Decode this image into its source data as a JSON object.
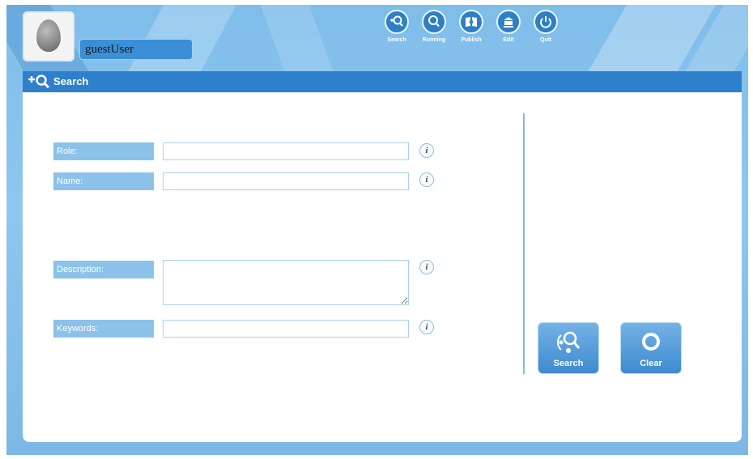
{
  "user": {
    "name": "guestUser"
  },
  "nav": [
    {
      "label": "Search",
      "icon": "search-icon"
    },
    {
      "label": "Running",
      "icon": "running-icon"
    },
    {
      "label": "Publish",
      "icon": "publish-icon"
    },
    {
      "label": "Edit",
      "icon": "edit-icon"
    },
    {
      "label": "Quit",
      "icon": "power-icon"
    }
  ],
  "title_bar": {
    "title": "Search"
  },
  "form": {
    "role": {
      "label": "Role:",
      "value": ""
    },
    "name": {
      "label": "Name:",
      "value": ""
    },
    "description": {
      "label": "Description:",
      "value": ""
    },
    "keywords": {
      "label": "Keywords:",
      "value": ""
    },
    "info_glyph": "i"
  },
  "actions": {
    "search_label": "Search",
    "clear_label": "Clear"
  },
  "colors": {
    "accent": "#2f80cc",
    "label_bg": "#8cc2ea",
    "background": "#8ec7ef"
  }
}
